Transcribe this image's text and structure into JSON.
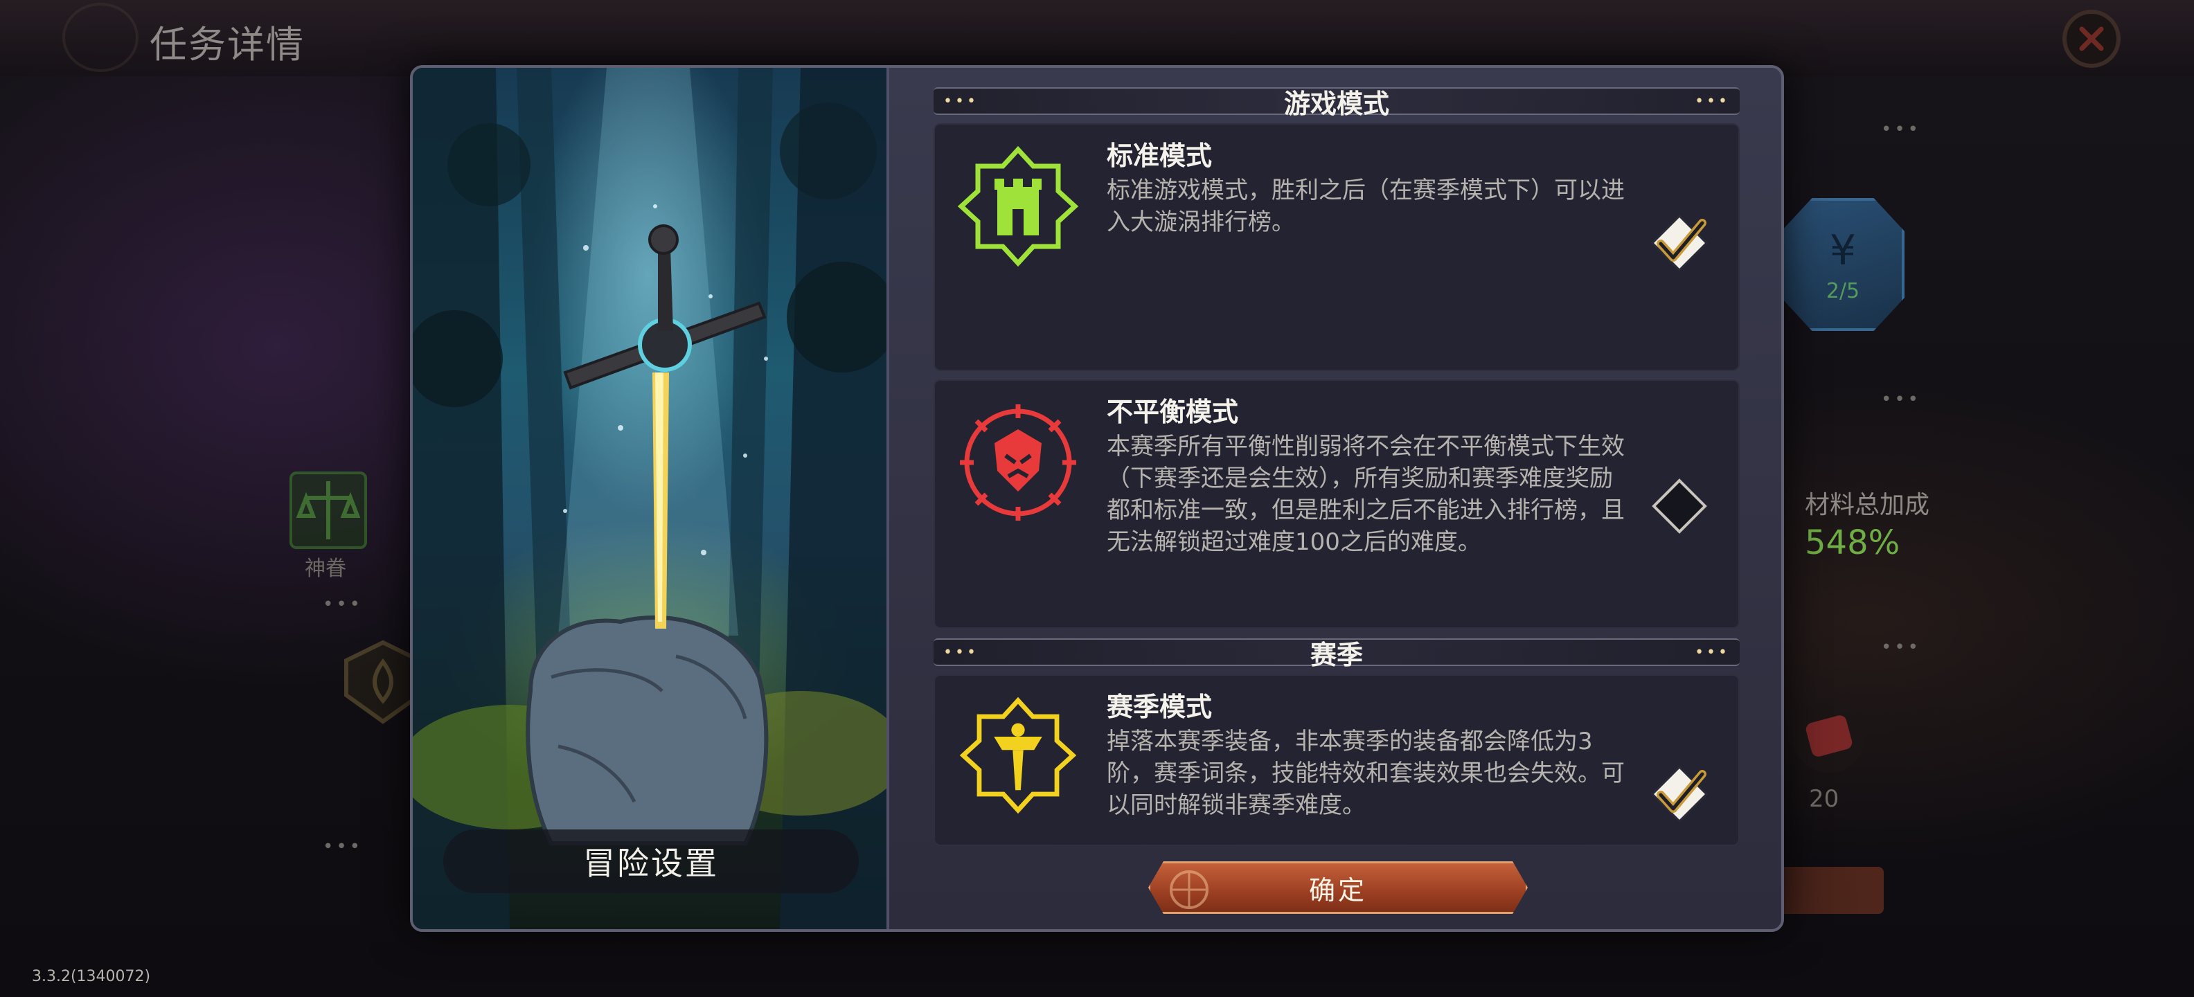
{
  "background": {
    "title": "任务详情",
    "bonus_label": "神眷",
    "materials_label": "材料总加成",
    "materials_value": "548%",
    "blue_badge_count": "2/5",
    "item_count": "20"
  },
  "version": "3.3.2(1340072)",
  "modal": {
    "art_caption": "冒险设置",
    "sections": [
      {
        "title": "游戏模式"
      },
      {
        "title": "赛季"
      }
    ],
    "modes": [
      {
        "name": "标准模式",
        "description": "标准游戏模式，胜利之后（在赛季模式下）可以进入大漩涡排行榜。",
        "checked": true,
        "color": "#9fe33a"
      },
      {
        "name": "不平衡模式",
        "description": "本赛季所有平衡性削弱将不会在不平衡模式下生效（下赛季还是会生效），所有奖励和赛季难度奖励都和标准一致，但是胜利之后不能进入排行榜，且无法解锁超过难度100之后的难度。",
        "checked": false,
        "color": "#e83a3a"
      },
      {
        "name": "赛季模式",
        "description": "掉落本赛季装备，非本赛季的装备都会降低为3阶，赛季词条，技能特效和套装效果也会失效。可以同时解锁非赛季难度。",
        "checked": true,
        "color": "#f2d21e"
      }
    ],
    "confirm_label": "确定"
  },
  "colors": {
    "accent_orange": "#b44e2c",
    "gold": "#e8c477",
    "panel": "#232331"
  }
}
